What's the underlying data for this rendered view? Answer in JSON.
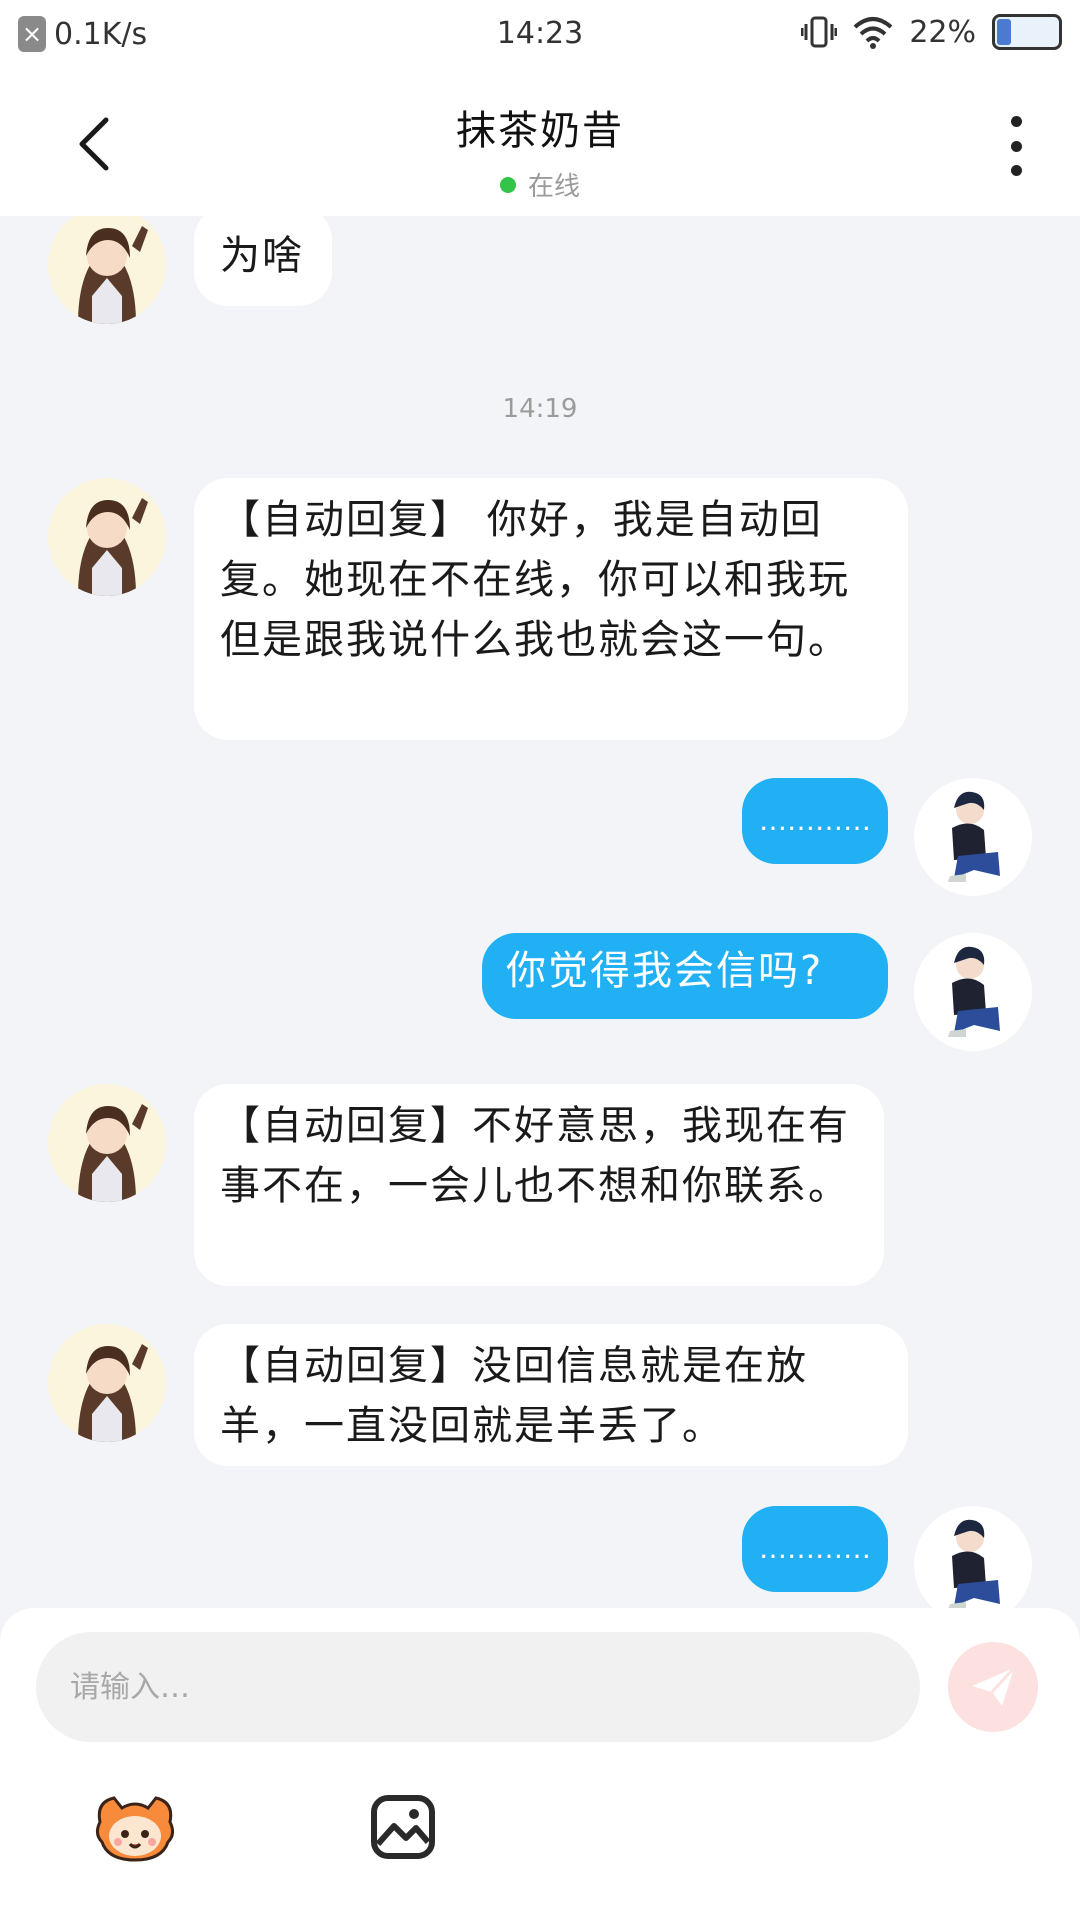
{
  "status_bar": {
    "speed": "0.1K/s",
    "time": "14:23",
    "battery": "22%",
    "battery_level": 0.22
  },
  "header": {
    "title": "抹茶奶昔",
    "status": "在线"
  },
  "messages": [
    {
      "side": "in",
      "text": "为啥"
    },
    {
      "side": "time",
      "text": "14:19"
    },
    {
      "side": "in",
      "text": "【自动回复】 你好，我是自动回复。她现在不在线，你可以和我玩但是跟我说什么我也就会这一句。"
    },
    {
      "side": "out",
      "text": "…………"
    },
    {
      "side": "out",
      "text": "你觉得我会信吗?"
    },
    {
      "side": "in",
      "text": "【自动回复】不好意思，我现在有事不在，一会儿也不想和你联系。"
    },
    {
      "side": "in",
      "text": "【自动回复】没回信息就是在放羊，一直没回就是羊丢了。"
    },
    {
      "side": "out",
      "text": "…………"
    }
  ],
  "input": {
    "placeholder": "请输入…"
  },
  "icons": {
    "back": "chevron-left-icon",
    "more": "more-vertical-icon",
    "send": "send-icon",
    "emoji": "emoji-mascot-icon",
    "image": "image-icon"
  },
  "colors": {
    "accent": "#21b0f3",
    "online": "#33c44a",
    "send_disabled": "#fde0e0"
  }
}
